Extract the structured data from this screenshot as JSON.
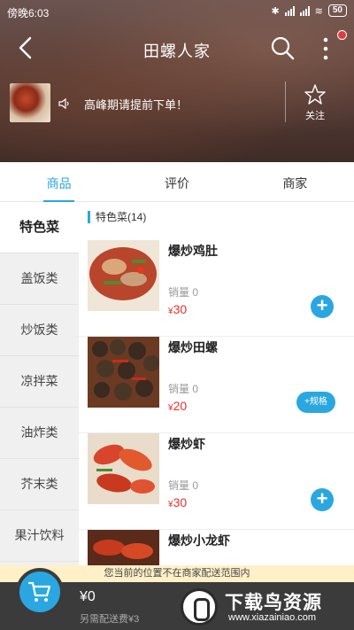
{
  "status_bar": {
    "time": "傍晚6:03",
    "battery": "50"
  },
  "nav": {
    "title": "田螺人家"
  },
  "shop": {
    "notice": "高峰期请提前下单！",
    "favorite_label": "关注"
  },
  "tabs": [
    {
      "label": "商品",
      "active": true
    },
    {
      "label": "评价",
      "active": false
    },
    {
      "label": "商家",
      "active": false
    }
  ],
  "categories": [
    {
      "label": "特色菜",
      "active": true
    },
    {
      "label": "盖饭类",
      "active": false
    },
    {
      "label": "炒饭类",
      "active": false
    },
    {
      "label": "凉拌菜",
      "active": false
    },
    {
      "label": "油炸类",
      "active": false
    },
    {
      "label": "芥末类",
      "active": false
    },
    {
      "label": "果汁饮料",
      "active": false
    }
  ],
  "section": {
    "title": "特色菜(14)"
  },
  "items": [
    {
      "name": "爆炒鸡肚",
      "sales": "销量 0",
      "currency": "¥",
      "price": "30",
      "action": "+"
    },
    {
      "name": "爆炒田螺",
      "sales": "销量 0",
      "currency": "¥",
      "price": "20",
      "action": "+规格"
    },
    {
      "name": "爆炒虾",
      "sales": "销量 0",
      "currency": "¥",
      "price": "30",
      "action": "+"
    },
    {
      "name": "爆炒小龙虾"
    }
  ],
  "bottom": {
    "warning": "您当前的位置不在商家配送范围内",
    "total": "¥0",
    "delivery_fee": "另需配送费¥3"
  },
  "watermark": {
    "brand": "下载鸟资源",
    "url": "www.xiazainiao.com"
  },
  "colors": {
    "accent": "#2aa7e0",
    "price": "#e5322d",
    "cart_bar": "#3b3b3b"
  }
}
